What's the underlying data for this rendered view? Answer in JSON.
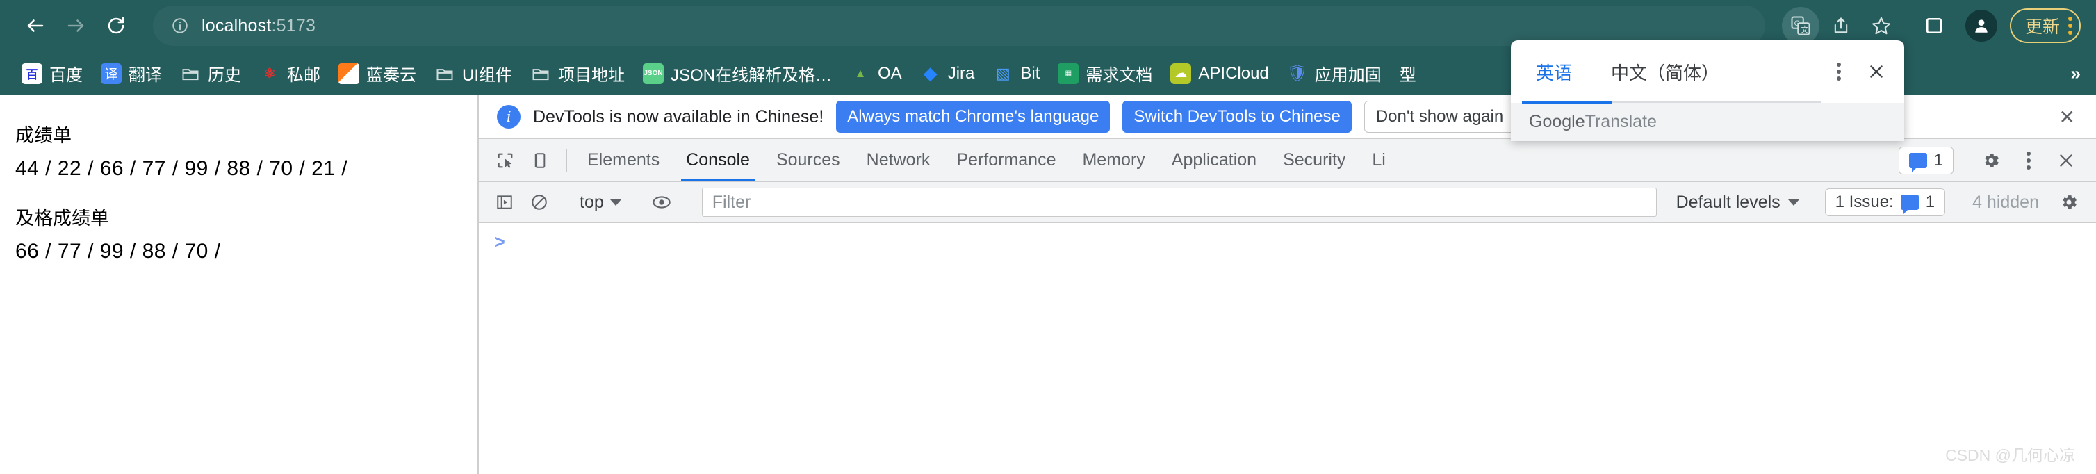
{
  "browser": {
    "nav": {
      "back": "back-arrow",
      "forward": "forward-arrow",
      "reload": "reload"
    },
    "omnibox": {
      "host": "localhost",
      "port": ":5173",
      "site_info_icon": "info-circle-icon"
    },
    "actions": {
      "translate_icon": "google-translate-icon",
      "share_icon": "share-icon",
      "bookmark_icon": "star-icon",
      "side_panel_icon": "side-panel-icon",
      "profile_icon": "profile-avatar-icon",
      "update_label": "更新",
      "menu_icon": "three-dot-menu-icon"
    },
    "bookmarks": [
      {
        "label": "百度",
        "icon": "baidu-icon"
      },
      {
        "label": "翻译",
        "icon": "translate-icon"
      },
      {
        "label": "历史",
        "icon": "folder-icon"
      },
      {
        "label": "私邮",
        "icon": "simail-icon"
      },
      {
        "label": "蓝奏云",
        "icon": "lanzou-icon"
      },
      {
        "label": "UI组件",
        "icon": "folder-icon"
      },
      {
        "label": "项目地址",
        "icon": "folder-icon"
      },
      {
        "label": "JSON在线解析及格…",
        "icon": "json-icon"
      },
      {
        "label": "OA",
        "icon": "oa-icon"
      },
      {
        "label": "Jira",
        "icon": "jira-icon"
      },
      {
        "label": "Bit",
        "icon": "bit-icon"
      },
      {
        "label": "需求文档",
        "icon": "sheets-icon"
      },
      {
        "label": "APICloud",
        "icon": "apicloud-icon"
      },
      {
        "label": "应用加固",
        "icon": "shield-icon"
      },
      {
        "label": "型",
        "icon": "none"
      }
    ],
    "bookmarks_overflow": "»"
  },
  "page": {
    "sections": [
      {
        "heading": "成绩单",
        "values": "44 / 22 / 66 / 77 / 99 / 88 / 70 / 21 /"
      },
      {
        "heading": "及格成绩单",
        "values": "66 / 77 / 99 / 88 / 70 /"
      }
    ]
  },
  "devtools": {
    "banner": {
      "message": "DevTools is now available in Chinese!",
      "primary_button": "Always match Chrome's language",
      "secondary_button": "Switch DevTools to Chinese",
      "tertiary_button": "Don't show again",
      "close_icon": "close-icon",
      "info_icon": "info-icon"
    },
    "tabs": [
      {
        "label": "Elements",
        "active": false
      },
      {
        "label": "Console",
        "active": true
      },
      {
        "label": "Sources",
        "active": false
      },
      {
        "label": "Network",
        "active": false
      },
      {
        "label": "Performance",
        "active": false
      },
      {
        "label": "Memory",
        "active": false
      },
      {
        "label": "Application",
        "active": false
      },
      {
        "label": "Security",
        "active": false
      },
      {
        "label": "Li",
        "active": false
      }
    ],
    "tabs_right": {
      "issue_count": "1",
      "settings_icon": "gear-icon",
      "more_icon": "three-dot-menu-icon",
      "close_icon": "close-icon"
    },
    "console_toolbar": {
      "sidebar_icon": "console-sidebar-icon",
      "clear_icon": "clear-console-icon",
      "context": "top",
      "eye_icon": "live-expression-eye-icon",
      "filter_placeholder": "Filter",
      "filter_value": "",
      "levels": "Default levels",
      "issues_label": "1 Issue:",
      "issues_count": "1",
      "hidden_label": "4 hidden",
      "settings_icon": "gear-icon"
    },
    "prompt": ">"
  },
  "translate_popup": {
    "tabs": [
      {
        "label": "英语",
        "active": true
      },
      {
        "label": "中文（简体）",
        "active": false
      }
    ],
    "menu_icon": "three-dot-menu-icon",
    "close_icon": "close-icon",
    "footer_brand": "Google",
    "footer_product": " Translate"
  },
  "watermark": "CSDN @几何心凉",
  "colors": {
    "chrome_bg": "#255c5c",
    "omnibox_bg": "#2d6363",
    "accent_blue": "#3b7ef2",
    "tab_active": "#1a73e8",
    "update_yellow": "#f0d98c"
  }
}
